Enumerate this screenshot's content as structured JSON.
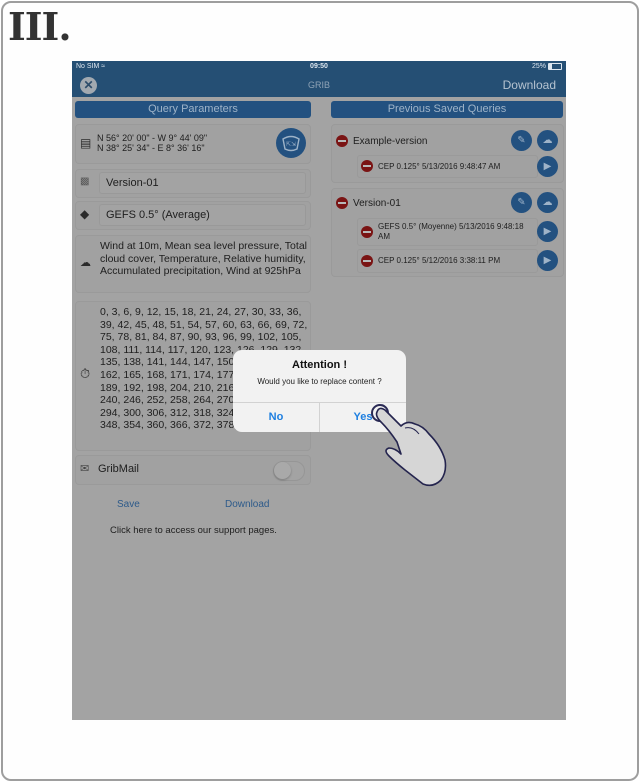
{
  "step_label": "III.",
  "status_bar": {
    "carrier": "No SIM",
    "time": "09:50",
    "battery": "25%"
  },
  "nav": {
    "title": "GRIB",
    "download_label": "Download",
    "close_icon": "close-icon"
  },
  "left": {
    "header": "Query Parameters",
    "coords": {
      "line1": "N 56° 20' 00\" - W 9° 44' 09\"",
      "line2": "N 38° 25' 34\" - E 8° 36' 16\""
    },
    "name_value": "Version-01",
    "model_value": "GEFS 0.5° (Average)",
    "parameters": "Wind at 10m, Mean sea level pressure, Total cloud cover, Temperature, Relative humidity, Accumulated precipitation, Wind at 925hPa",
    "hours": "0, 3, 6, 9, 12, 15, 18, 21, 24, 27, 30, 33, 36, 39, 42, 45, 48, 51, 54, 57, 60, 63, 66, 69, 72, 75, 78, 81, 84, 87, 90, 93, 96, 99, 102, 105, 108, 111, 114, 117, 120, 123, 126, 129, 132, 135, 138, 141, 144, 147, 150, 153, 156, 159, 162, 165, 168, 171, 174, 177, 180, 183, 186, 189, 192, 198, 204, 210, 216, 222, 228, 234, 240, 246, 252, 258, 264, 270, 276, 282, 288, 294, 300, 306, 312, 318, 324, 330, 336, 342, 348, 354, 360, 366, 372, 378, 384",
    "gribmail_label": "GribMail",
    "gribmail_on": false,
    "save_label": "Save",
    "download_label": "Download",
    "support_text": "Click here to access our support pages."
  },
  "right": {
    "header": "Previous Saved Queries",
    "queries": [
      {
        "title": "Example-version",
        "items": [
          {
            "text": "CEP 0.125° 5/13/2016 9:48:47 AM"
          }
        ]
      },
      {
        "title": "Version-01",
        "items": [
          {
            "text": "GEFS 0.5° (Moyenne) 5/13/2016 9:48:18 AM"
          },
          {
            "text": "CEP 0.125° 5/12/2016 3:38:11 PM"
          }
        ]
      }
    ]
  },
  "alert": {
    "title": "Attention !",
    "message": "Would you like to replace content ?",
    "no_label": "No",
    "yes_label": "Yes"
  },
  "colors": {
    "accent": "#235180",
    "nav": "#254f74",
    "alert_button": "#1e7fe0",
    "overlay": "#a3a3a3"
  }
}
